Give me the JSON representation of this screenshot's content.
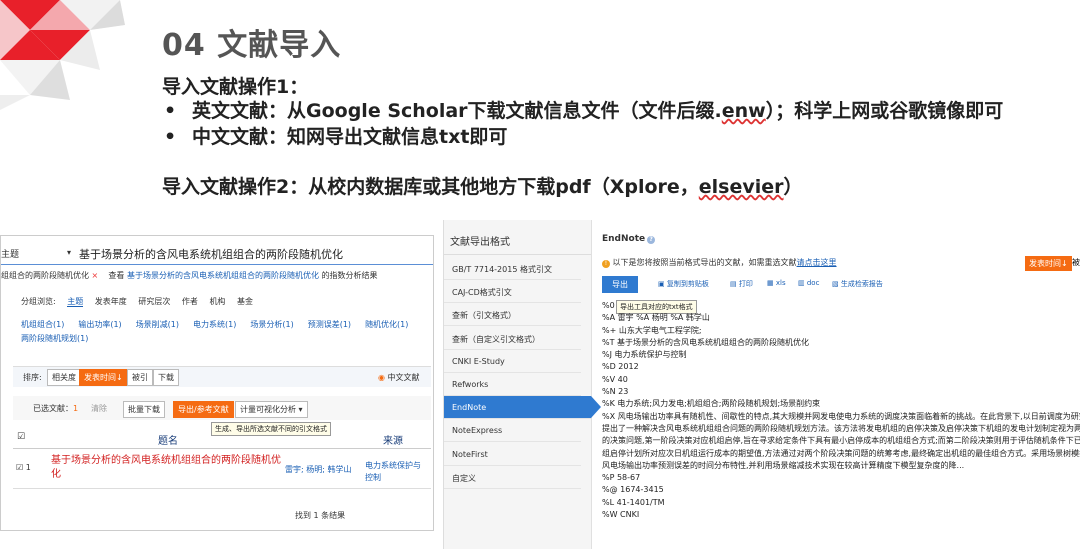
{
  "slide": {
    "title": "04 文献导入",
    "op1": "导入文献操作1：",
    "bullet": "•",
    "b1_pre": "英文文献：从Google Scholar下载文献信息文件（文件后缀.",
    "b1_ext": "enw",
    "b1_post": "）；科学上网或谷歌镜像即可",
    "b2": "中文文献：知网导出文献信息txt即可",
    "op2_pre": "导入文献操作2：从校内数据库或其他地方下载pdf（Xplore，",
    "op2_wavy": "elsevier",
    "op2_post": "）"
  },
  "left": {
    "field_select": "主题",
    "query": "基于场景分析的含风电系统机组组合的两阶段随机优化",
    "breadcrumb": "组组合的两阶段随机优化",
    "close": "×",
    "view_pre": "查看",
    "view_link": "基于场景分析的含风电系统机组组合的两阶段随机优化",
    "view_post": "的指数分析结果",
    "facet_label": "分组浏览:",
    "facets": [
      "主题",
      "发表年度",
      "研究层次",
      "作者",
      "机构",
      "基金"
    ],
    "chips": [
      "机组组合(1)",
      "输出功率(1)",
      "场景削减(1)",
      "电力系统(1)",
      "场景分析(1)",
      "预测误差(1)",
      "随机优化(1)",
      "两阶段随机规划(1)"
    ],
    "sort_label": "排序:",
    "sort_relevance": "相关度",
    "sort_time": "发表时间↓",
    "sort_cited": "被引",
    "sort_download": "下载",
    "cn_docs": "中文文献",
    "selected_label": "已选文献：",
    "selected_count": "1",
    "clear": "清除",
    "batch_download": "批量下载",
    "export_ref": "导出/参考文献",
    "visual_analysis": "计量可视化分析",
    "dropdown_arrow": "▾",
    "tooltip": "生成、导出所选文献不同的引文格式",
    "col_title": "题名",
    "col_source": "来源",
    "row_no": "1",
    "row_title": "基于场景分析的含风电系统机组组合的两阶段随机优化",
    "row_authors": "雷宇; 杨明; 韩学山",
    "row_source": "电力系统保护与控制",
    "found": "找到 1 条结果"
  },
  "right": {
    "sidebar_header": "文献导出格式",
    "formats": [
      "GB/T 7714-2015 格式引文",
      "CAJ-CD格式引文",
      "查新（引文格式）",
      "查新（自定义引文格式）",
      "CNKI E-Study",
      "Refworks",
      "EndNote",
      "NoteExpress",
      "NoteFirst",
      "自定义"
    ],
    "active_index": 6,
    "main_title": "EndNote",
    "hint_pre": "以下是您将按照当前格式导出的文献，如需重选文献",
    "hint_link": "请点击这里",
    "sort_time": "发表时间↓",
    "sort_cut": "被",
    "export_btn": "导出",
    "tools": [
      "复制到剪贴板",
      "打印",
      "xls",
      "doc",
      "生成检索报告"
    ],
    "tooltip": "导出工具对应的txt格式",
    "lines": [
      "%0",
      "%A 雷宇 %A 杨明 %A 韩学山",
      "%+ 山东大学电气工程学院;",
      "%T 基于场景分析的含风电系统机组组合的两阶段随机优化",
      "%J 电力系统保护与控制",
      "%D 2012",
      "%V 40",
      "%N 23",
      "%K 电力系统;风力发电;机组组合;两阶段随机规划;场景削约束",
      "%X 风电场输出功率具有随机性、间歇性的特点,其大规模并网发电使电力系统的调度决策面临着新的挑战。在此背景下,以日前调度为研究",
      "提出了一种解决含风电系统机组组合问题的两阶段随机规划方法。该方法将发电机组的启停决策及启停决策下机组的发电计划制定视为两",
      "的决策问题,第一阶段决策对应机组启停,旨在寻求给定条件下具有最小启停成本的机组组合方式;而第二阶段决策则用于评估随机条件下已",
      "组启停计划所对应次日机组运行成本的期望值,方法通过对两个阶段决策问题的统筹考虑,最终确定出机组的最佳组合方式。采用场景树模拟",
      "风电场输出功率预测误差的时间分布特性,并利用场景缩减技术实现在较高计算精度下模型复杂度的降...",
      "%P 58-67",
      "%@ 1674-3415",
      "%L 41-1401/TM",
      "%W CNKI"
    ]
  },
  "colors": {
    "accent_orange": "#f56b12",
    "accent_blue": "#2f7ad0",
    "link_blue": "#1a5fb4",
    "title_red": "#d21f1f",
    "deco_red": "#e8202a"
  }
}
